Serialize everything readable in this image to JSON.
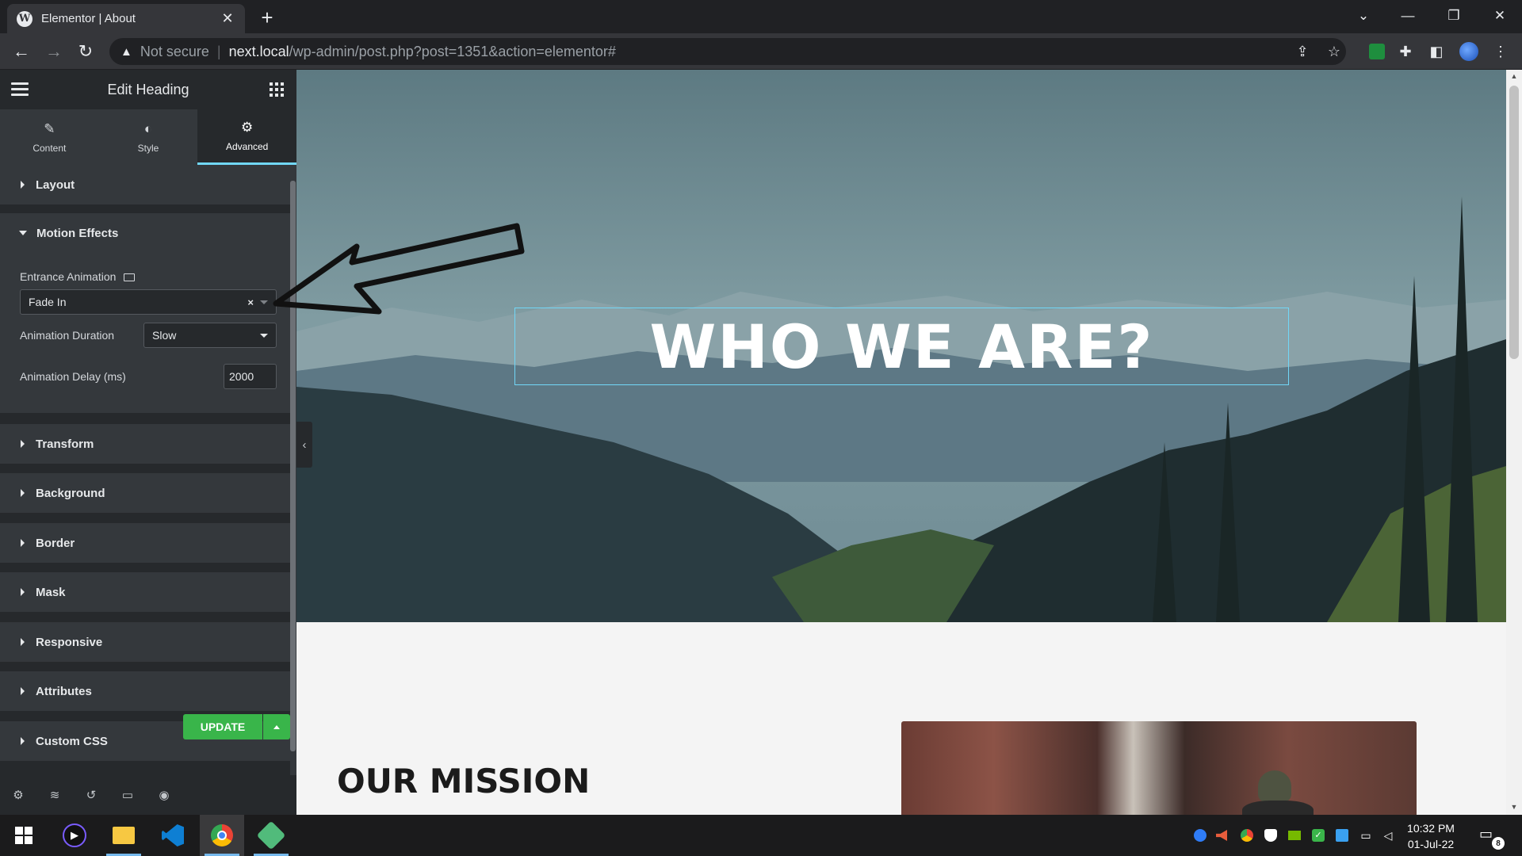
{
  "browser": {
    "tab_title": "Elementor | About",
    "tab_close": "✕",
    "new_tab": "+",
    "address": {
      "security_label": "Not secure",
      "host": "next.local",
      "path": "/wp-admin/post.php?post=1351&action=elementor#"
    }
  },
  "panel": {
    "title": "Edit Heading",
    "tabs": [
      {
        "label": "Content",
        "icon": "pencil-icon"
      },
      {
        "label": "Style",
        "icon": "half-circle-icon"
      },
      {
        "label": "Advanced",
        "icon": "gear-icon",
        "active": true
      }
    ],
    "sections": {
      "layout": "Layout",
      "motion_effects": "Motion Effects",
      "transform": "Transform",
      "background": "Background",
      "border": "Border",
      "mask": "Mask",
      "responsive": "Responsive",
      "attributes": "Attributes",
      "custom_css": "Custom CSS"
    },
    "motion": {
      "entrance_label": "Entrance Animation",
      "entrance_value": "Fade In",
      "duration_label": "Animation Duration",
      "duration_value": "Slow",
      "delay_label": "Animation Delay (ms)",
      "delay_value": "2000"
    },
    "footer": {
      "update_label": "UPDATE"
    }
  },
  "preview": {
    "hero_heading": "WHO WE ARE?",
    "mission_heading": "OUR MISSION"
  },
  "taskbar": {
    "time": "10:32 PM",
    "date": "01-Jul-22",
    "notification_count": "8"
  },
  "colors": {
    "accent": "#71d7f7",
    "update_green": "#39b54a",
    "panel_dark": "#26292c",
    "panel_section": "#34383c"
  }
}
